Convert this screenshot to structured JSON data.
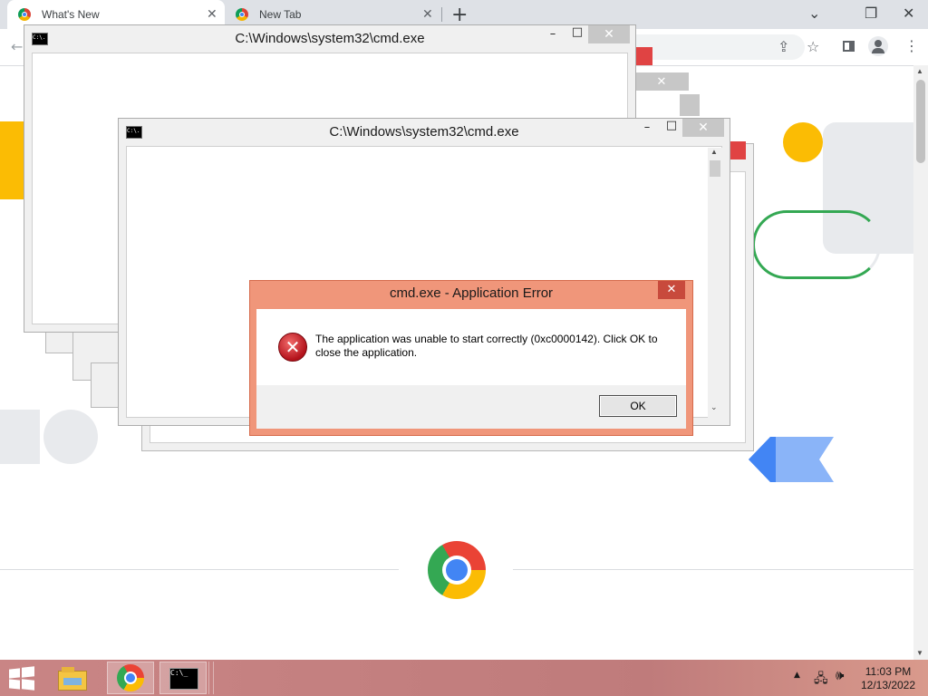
{
  "browser": {
    "tabs": [
      {
        "label": "What's New",
        "close": "✕"
      },
      {
        "label": "New Tab",
        "close": "✕"
      }
    ],
    "new_tab": "+",
    "window_controls": [
      "⌄",
      "❐",
      "✕"
    ],
    "toolbar_icons": [
      "share-icon",
      "star-icon",
      "sidebar-icon",
      "profile-icon",
      "menu-icon"
    ]
  },
  "cmd_windows": [
    {
      "title": "C:\\Windows\\system32\\cmd.exe",
      "icon_text": "C:\\."
    },
    {
      "title": "C:\\Windows\\system32\\cmd.exe",
      "icon_text": "C:\\."
    }
  ],
  "dialog": {
    "title": "cmd.exe - Application Error",
    "close": "✕",
    "message": "The application was unable to start correctly (0xc0000142). Click OK to close the application.",
    "ok": "OK",
    "icon": "error-icon"
  },
  "taskbar": {
    "items": [
      "start-icon",
      "file-explorer-icon",
      "chrome-icon",
      "cmd-icon"
    ],
    "time": "11:03 PM",
    "date": "12/13/2022"
  },
  "colors": {
    "dialog_frame": "#f0967a",
    "taskbar": "#c27d7d",
    "accent_blue": "#4285f4",
    "accent_yellow": "#fbbc04",
    "accent_green": "#34a853",
    "accent_red": "#ea4335"
  }
}
